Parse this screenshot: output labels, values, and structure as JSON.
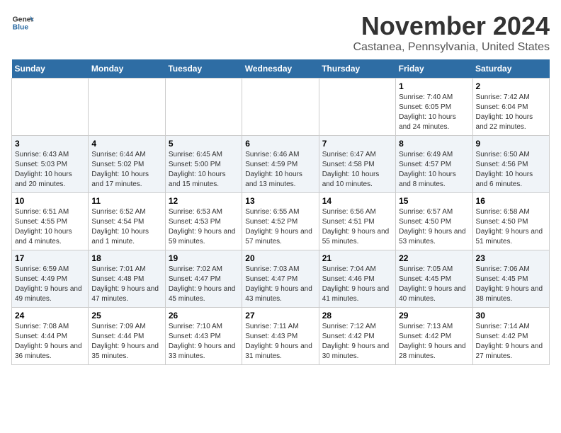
{
  "header": {
    "logo_line1": "General",
    "logo_line2": "Blue",
    "month_title": "November 2024",
    "location": "Castanea, Pennsylvania, United States"
  },
  "weekdays": [
    "Sunday",
    "Monday",
    "Tuesday",
    "Wednesday",
    "Thursday",
    "Friday",
    "Saturday"
  ],
  "weeks": [
    [
      {
        "day": "",
        "sunrise": "",
        "sunset": "",
        "daylight": ""
      },
      {
        "day": "",
        "sunrise": "",
        "sunset": "",
        "daylight": ""
      },
      {
        "day": "",
        "sunrise": "",
        "sunset": "",
        "daylight": ""
      },
      {
        "day": "",
        "sunrise": "",
        "sunset": "",
        "daylight": ""
      },
      {
        "day": "",
        "sunrise": "",
        "sunset": "",
        "daylight": ""
      },
      {
        "day": "1",
        "sunrise": "Sunrise: 7:40 AM",
        "sunset": "Sunset: 6:05 PM",
        "daylight": "Daylight: 10 hours and 24 minutes."
      },
      {
        "day": "2",
        "sunrise": "Sunrise: 7:42 AM",
        "sunset": "Sunset: 6:04 PM",
        "daylight": "Daylight: 10 hours and 22 minutes."
      }
    ],
    [
      {
        "day": "3",
        "sunrise": "Sunrise: 6:43 AM",
        "sunset": "Sunset: 5:03 PM",
        "daylight": "Daylight: 10 hours and 20 minutes."
      },
      {
        "day": "4",
        "sunrise": "Sunrise: 6:44 AM",
        "sunset": "Sunset: 5:02 PM",
        "daylight": "Daylight: 10 hours and 17 minutes."
      },
      {
        "day": "5",
        "sunrise": "Sunrise: 6:45 AM",
        "sunset": "Sunset: 5:00 PM",
        "daylight": "Daylight: 10 hours and 15 minutes."
      },
      {
        "day": "6",
        "sunrise": "Sunrise: 6:46 AM",
        "sunset": "Sunset: 4:59 PM",
        "daylight": "Daylight: 10 hours and 13 minutes."
      },
      {
        "day": "7",
        "sunrise": "Sunrise: 6:47 AM",
        "sunset": "Sunset: 4:58 PM",
        "daylight": "Daylight: 10 hours and 10 minutes."
      },
      {
        "day": "8",
        "sunrise": "Sunrise: 6:49 AM",
        "sunset": "Sunset: 4:57 PM",
        "daylight": "Daylight: 10 hours and 8 minutes."
      },
      {
        "day": "9",
        "sunrise": "Sunrise: 6:50 AM",
        "sunset": "Sunset: 4:56 PM",
        "daylight": "Daylight: 10 hours and 6 minutes."
      }
    ],
    [
      {
        "day": "10",
        "sunrise": "Sunrise: 6:51 AM",
        "sunset": "Sunset: 4:55 PM",
        "daylight": "Daylight: 10 hours and 4 minutes."
      },
      {
        "day": "11",
        "sunrise": "Sunrise: 6:52 AM",
        "sunset": "Sunset: 4:54 PM",
        "daylight": "Daylight: 10 hours and 1 minute."
      },
      {
        "day": "12",
        "sunrise": "Sunrise: 6:53 AM",
        "sunset": "Sunset: 4:53 PM",
        "daylight": "Daylight: 9 hours and 59 minutes."
      },
      {
        "day": "13",
        "sunrise": "Sunrise: 6:55 AM",
        "sunset": "Sunset: 4:52 PM",
        "daylight": "Daylight: 9 hours and 57 minutes."
      },
      {
        "day": "14",
        "sunrise": "Sunrise: 6:56 AM",
        "sunset": "Sunset: 4:51 PM",
        "daylight": "Daylight: 9 hours and 55 minutes."
      },
      {
        "day": "15",
        "sunrise": "Sunrise: 6:57 AM",
        "sunset": "Sunset: 4:50 PM",
        "daylight": "Daylight: 9 hours and 53 minutes."
      },
      {
        "day": "16",
        "sunrise": "Sunrise: 6:58 AM",
        "sunset": "Sunset: 4:50 PM",
        "daylight": "Daylight: 9 hours and 51 minutes."
      }
    ],
    [
      {
        "day": "17",
        "sunrise": "Sunrise: 6:59 AM",
        "sunset": "Sunset: 4:49 PM",
        "daylight": "Daylight: 9 hours and 49 minutes."
      },
      {
        "day": "18",
        "sunrise": "Sunrise: 7:01 AM",
        "sunset": "Sunset: 4:48 PM",
        "daylight": "Daylight: 9 hours and 47 minutes."
      },
      {
        "day": "19",
        "sunrise": "Sunrise: 7:02 AM",
        "sunset": "Sunset: 4:47 PM",
        "daylight": "Daylight: 9 hours and 45 minutes."
      },
      {
        "day": "20",
        "sunrise": "Sunrise: 7:03 AM",
        "sunset": "Sunset: 4:47 PM",
        "daylight": "Daylight: 9 hours and 43 minutes."
      },
      {
        "day": "21",
        "sunrise": "Sunrise: 7:04 AM",
        "sunset": "Sunset: 4:46 PM",
        "daylight": "Daylight: 9 hours and 41 minutes."
      },
      {
        "day": "22",
        "sunrise": "Sunrise: 7:05 AM",
        "sunset": "Sunset: 4:45 PM",
        "daylight": "Daylight: 9 hours and 40 minutes."
      },
      {
        "day": "23",
        "sunrise": "Sunrise: 7:06 AM",
        "sunset": "Sunset: 4:45 PM",
        "daylight": "Daylight: 9 hours and 38 minutes."
      }
    ],
    [
      {
        "day": "24",
        "sunrise": "Sunrise: 7:08 AM",
        "sunset": "Sunset: 4:44 PM",
        "daylight": "Daylight: 9 hours and 36 minutes."
      },
      {
        "day": "25",
        "sunrise": "Sunrise: 7:09 AM",
        "sunset": "Sunset: 4:44 PM",
        "daylight": "Daylight: 9 hours and 35 minutes."
      },
      {
        "day": "26",
        "sunrise": "Sunrise: 7:10 AM",
        "sunset": "Sunset: 4:43 PM",
        "daylight": "Daylight: 9 hours and 33 minutes."
      },
      {
        "day": "27",
        "sunrise": "Sunrise: 7:11 AM",
        "sunset": "Sunset: 4:43 PM",
        "daylight": "Daylight: 9 hours and 31 minutes."
      },
      {
        "day": "28",
        "sunrise": "Sunrise: 7:12 AM",
        "sunset": "Sunset: 4:42 PM",
        "daylight": "Daylight: 9 hours and 30 minutes."
      },
      {
        "day": "29",
        "sunrise": "Sunrise: 7:13 AM",
        "sunset": "Sunset: 4:42 PM",
        "daylight": "Daylight: 9 hours and 28 minutes."
      },
      {
        "day": "30",
        "sunrise": "Sunrise: 7:14 AM",
        "sunset": "Sunset: 4:42 PM",
        "daylight": "Daylight: 9 hours and 27 minutes."
      }
    ]
  ]
}
